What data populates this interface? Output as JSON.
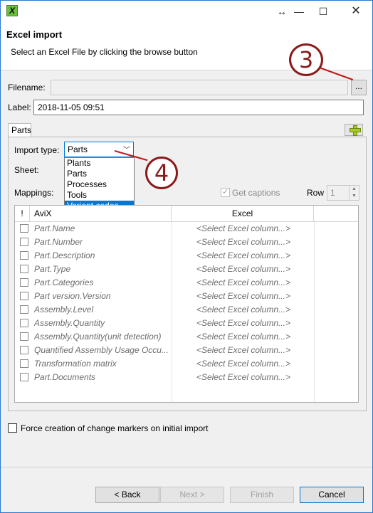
{
  "window": {
    "app_icon_letter": "X",
    "resize_symbol": "↔",
    "minimize_symbol": "—",
    "maximize_symbol": "☐",
    "close_symbol": "✕"
  },
  "header": {
    "title": "Excel import",
    "subtitle": "Select an Excel File by clicking the browse button"
  },
  "callouts": {
    "three": "3",
    "four": "4"
  },
  "form": {
    "filename_label": "Filename:",
    "filename_value": "",
    "browse_label": "...",
    "label_label": "Label:",
    "label_value": "2018-11-05 09:51"
  },
  "tabs": [
    {
      "label": "Parts"
    }
  ],
  "import": {
    "type_label": "Import type:",
    "type_value": "Parts",
    "options": [
      "Plants",
      "Parts",
      "Processes",
      "Tools",
      "Variant codes"
    ],
    "highlighted_option": "Variant codes",
    "sheet_label": "Sheet:",
    "mappings_label": "Mappings:",
    "get_captions_label": "Get captions",
    "get_captions_checked": true,
    "row_label": "Row",
    "row_value": "1"
  },
  "table": {
    "columns": {
      "check": "!",
      "avix": "AviX",
      "excel": "Excel"
    },
    "rows": [
      {
        "avix": "Part.Name",
        "excel": "<Select Excel column...>"
      },
      {
        "avix": "Part.Number",
        "excel": "<Select Excel column...>"
      },
      {
        "avix": "Part.Description",
        "excel": "<Select Excel column...>"
      },
      {
        "avix": "Part.Type",
        "excel": "<Select Excel column...>"
      },
      {
        "avix": "Part.Categories",
        "excel": "<Select Excel column...>"
      },
      {
        "avix": "Part version.Version",
        "excel": "<Select Excel column...>"
      },
      {
        "avix": "Assembly.Level",
        "excel": "<Select Excel column...>"
      },
      {
        "avix": "Assembly.Quantity",
        "excel": "<Select Excel column...>"
      },
      {
        "avix": "Assembly.Quantity(unit detection)",
        "excel": "<Select Excel column...>"
      },
      {
        "avix": "Quantified Assembly Usage Occu...",
        "excel": "<Select Excel column...>"
      },
      {
        "avix": "Transformation matrix",
        "excel": "<Select Excel column...>"
      },
      {
        "avix": "Part.Documents",
        "excel": "<Select Excel column...>"
      }
    ]
  },
  "options": {
    "force_markers_label": "Force creation of change markers on initial import",
    "force_markers_checked": false
  },
  "buttons": {
    "back": "< Back",
    "next": "Next >",
    "finish": "Finish",
    "cancel": "Cancel"
  },
  "colors": {
    "accent": "#0078d7",
    "callout": "#8b1a1a"
  }
}
